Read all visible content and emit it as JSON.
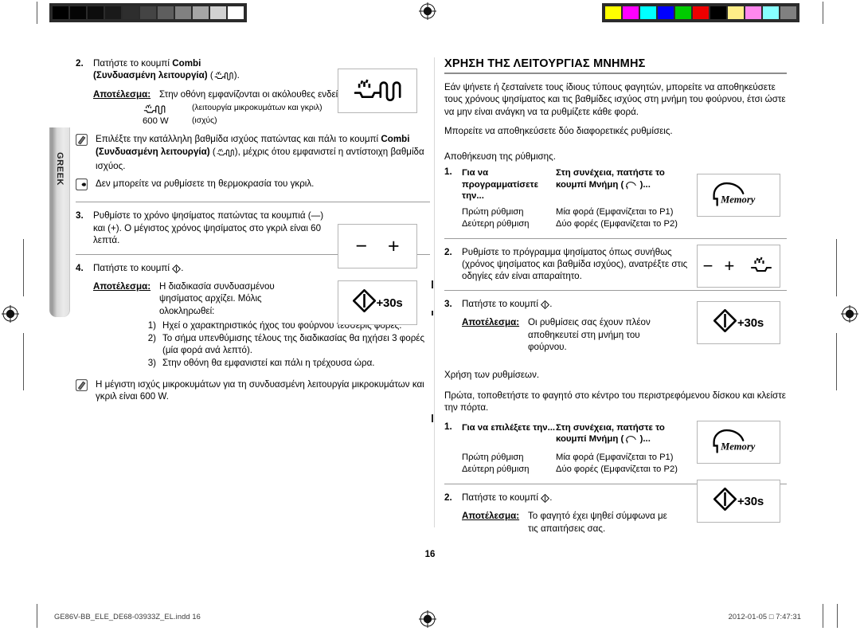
{
  "page": {
    "number": "16",
    "language_tab": "GREEK"
  },
  "calibration": {
    "grey_swatches": [
      "#000000",
      "#050505",
      "#0d0d0d",
      "#1a1a1a",
      "#2e2e2e",
      "#444444",
      "#5e5e5e",
      "#818181",
      "#a6a6a6",
      "#d2d2d2",
      "#ffffff"
    ],
    "color_swatches": [
      "#ffff00",
      "#ff00ff",
      "#00ffff",
      "#0000ff",
      "#00cc00",
      "#ee0000",
      "#000000",
      "#ffee88",
      "#ff88ee",
      "#88ffff",
      "#808080"
    ]
  },
  "left_column": {
    "step2": {
      "number": "2.",
      "text_before": "Πατήστε το κουμπί ",
      "bold1": "Combi",
      "bold2": "(Συνδυασμένη λειτουργία)",
      "text_after": " (",
      "text_end": ").",
      "result_label": "Αποτέλεσμα:",
      "result_text": "Στην οθόνη εμφανίζονται οι ακόλουθες ενδείξεις:",
      "display_rows": [
        {
          "key_icon": "combi-icon",
          "key_text": "",
          "value": "(λειτουργία μικροκυμάτων και γκριλ)"
        },
        {
          "key_icon": "",
          "key_text": "600 W",
          "value": "(ισχύς)"
        }
      ],
      "keybox_icon": "combi-icon"
    },
    "note1": {
      "icon": "note-pencil-icon",
      "text_a": "Επιλέξτε την κατάλληλη βαθμίδα ισχύος πατώντας και πάλι το κουμπί ",
      "bold": "Combi (Συνδυασμένη λειτουργία)",
      "text_b": " (",
      "text_c": "), μέχρις ότου εμφανιστεί η αντίστοιχη βαθμίδα ισχύος."
    },
    "note2": {
      "icon": "pointing-hand-icon",
      "text": "Δεν μπορείτε να ρυθμίσετε τη θερμοκρασία του γκριλ."
    },
    "step3": {
      "number": "3.",
      "text": "Ρυθμίστε το χρόνο ψησίματος πατώντας τα κουμπιά (—) και (+). Ο μέγιστος χρόνος ψησίματος στο γκριλ είναι 60 λεπτά.",
      "keybox_minus": "−",
      "keybox_plus": "+"
    },
    "step4": {
      "number": "4.",
      "text_before": "Πατήστε το κουμπί ",
      "text_after": ".",
      "result_label": "Αποτέλεσμα:",
      "result_text": "Η διαδικασία συνδυασμένου ψησίματος αρχίζει. Μόλις ολοκληρωθεί:",
      "sub_items": [
        {
          "marker": "1)",
          "text": "Ηχεί ο χαρακτηριστικός ήχος του φούρνου τέσσερις φορές."
        },
        {
          "marker": "2)",
          "text": "Το σήμα υπενθύμισης τέλους της διαδικασίας θα ηχήσει 3 φορές (μία φορά ανά λεπτό)."
        },
        {
          "marker": "3)",
          "text": "Στην οθόνη θα εμφανιστεί και πάλι η τρέχουσα ώρα."
        }
      ],
      "keybox_label": "+30s"
    },
    "note3": {
      "icon": "note-pencil-icon",
      "text": "Η μέγιστη ισχύς μικροκυμάτων για τη συνδυασμένη λειτουργία μικροκυμάτων και γκριλ είναι 600 W."
    }
  },
  "right_column": {
    "heading": "ΧΡΗΣΗ ΤΗΣ ΛΕΙΤΟΥΡΓΙΑΣ ΜΝΗΜΗΣ",
    "intro1": "Εάν ψήνετε ή ζεσταίνετε τους ίδιους τύπους φαγητών, μπορείτε να αποθηκεύσετε τους χρόνους ψησίματος και τις βαθμίδες ισχύος στη μνήμη του φούρνου, έτσι ώστε να μην είναι ανάγκη να τα ρυθμίζετε κάθε φορά.",
    "intro2": "Μπορείτε να αποθηκεύσετε δύο διαφορετικές ρυθμίσεις.",
    "section1_title": "Αποθήκευση της ρύθμισης.",
    "store": {
      "number": "1.",
      "header_col1": "Για να προγραμματίσετε την...",
      "header_col2_a": "Στη συνέχεια, πατήστε το",
      "header_col2_b": "κουμπί Μνήμη ( ",
      "header_col2_c": " )...",
      "rows": [
        {
          "col1": "Πρώτη ρύθμιση",
          "col2": "Μία φορά (Εμφανίζεται το P1)"
        },
        {
          "col1": "Δεύτερη ρύθμιση",
          "col2": "Δύο φορές (Εμφανίζεται το P2)"
        }
      ],
      "keybox_label": "Memory"
    },
    "step2": {
      "number": "2.",
      "text": "Ρυθμίστε το πρόγραμμα ψησίματος όπως συνήθως (χρόνος ψησίματος και βαθμίδα ισχύος), ανατρέξτε στις οδηγίες εάν είναι απαραίτητο.",
      "keybox_minus": "−",
      "keybox_plus": "+",
      "keybox_icon": "combi-icon"
    },
    "step3": {
      "number": "3.",
      "text_before": "Πατήστε το κουμπί ",
      "text_after": ".",
      "result_label": "Αποτέλεσμα:",
      "result_text": "Οι ρυθμίσεις σας έχουν πλέον αποθηκευτεί στη μνήμη του φούρνου.",
      "keybox_label": "+30s"
    },
    "section2_title": "Χρήση των ρυθμίσεων.",
    "section2_intro": "Πρώτα, τοποθετήστε το φαγητό στο κέντρο του περιστρεφόμενου δίσκου και κλείστε την πόρτα.",
    "use": {
      "number": "1.",
      "header_col1": "Για να επιλέξετε την...",
      "header_col2_a": "Στη συνέχεια, πατήστε το",
      "header_col2_b": "κουμπί Μνήμη ( ",
      "header_col2_c": " )...",
      "rows": [
        {
          "col1": "Πρώτη ρύθμιση",
          "col2": "Μία φορά (Εμφανίζεται το P1)"
        },
        {
          "col1": "Δεύτερη ρύθμιση",
          "col2": "Δύο φορές (Εμφανίζεται το P2)"
        }
      ],
      "keybox_label": "Memory"
    },
    "final_step": {
      "number": "2.",
      "text_before": "Πατήστε το κουμπί ",
      "text_after": ".",
      "result_label": "Αποτέλεσμα:",
      "result_text": "Το φαγητό έχει ψηθεί σύμφωνα με τις απαιτήσεις σας.",
      "keybox_label": "+30s"
    }
  },
  "footer": {
    "filename": "GE86V-BB_ELE_DE68-03933Z_EL.indd   16",
    "timestamp": "2012-01-05   □ 7:47:31"
  }
}
